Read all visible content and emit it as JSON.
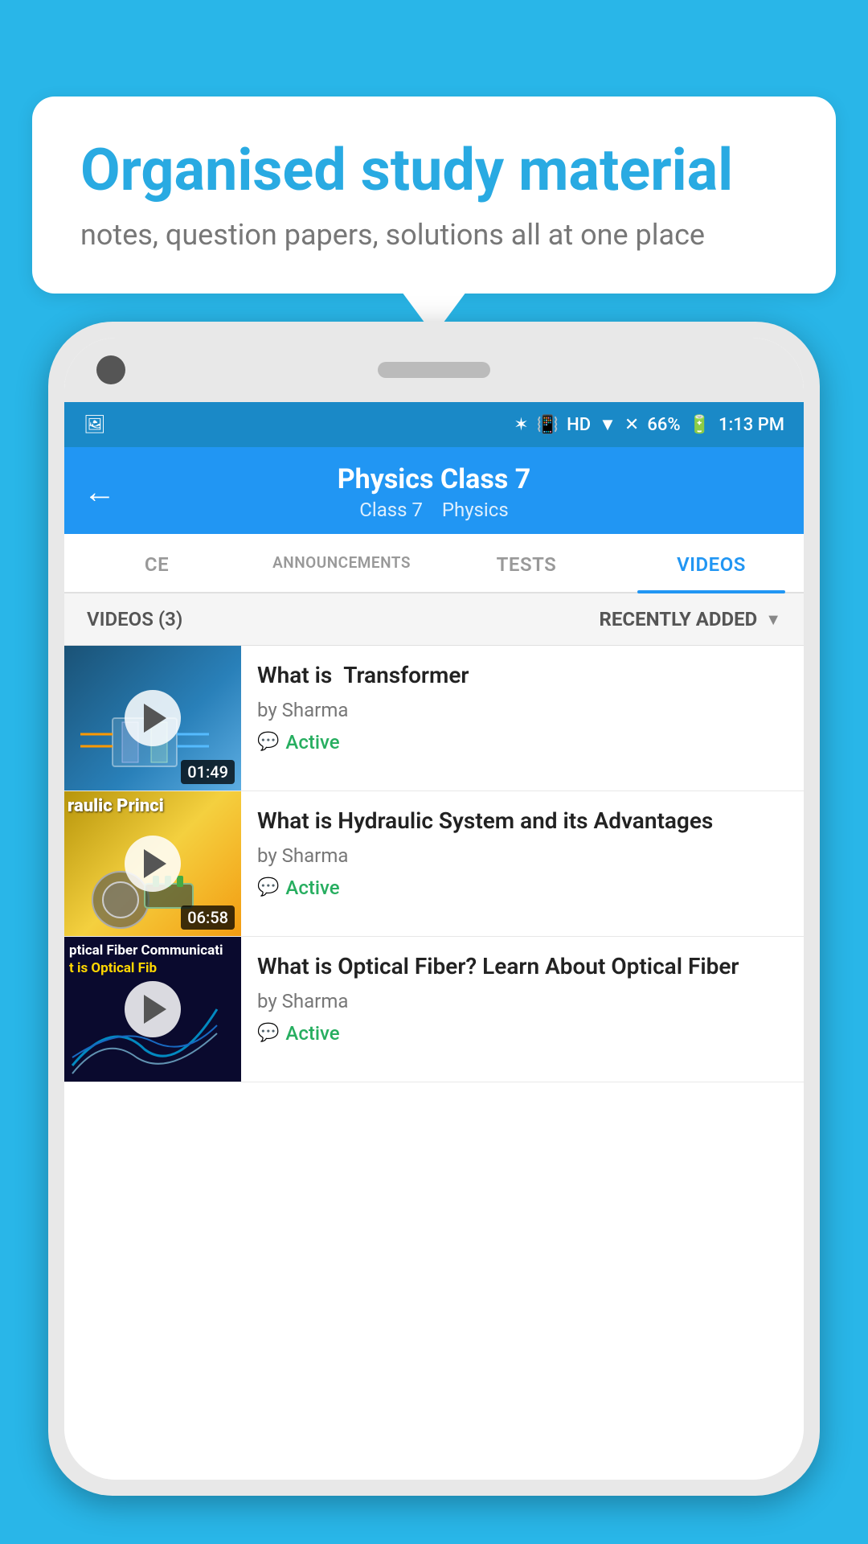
{
  "background_color": "#29b6e8",
  "speech_bubble": {
    "title": "Organised study material",
    "subtitle": "notes, question papers, solutions all at one place"
  },
  "status_bar": {
    "time": "1:13 PM",
    "battery": "66%",
    "signal_icons": "▲▲",
    "wifi_icon": "▼",
    "hd_label": "HD"
  },
  "header": {
    "title": "Physics Class 7",
    "subtitle_class": "Class 7",
    "subtitle_subject": "Physics",
    "back_label": "←"
  },
  "tabs": [
    {
      "id": "ce",
      "label": "CE",
      "active": false
    },
    {
      "id": "announcements",
      "label": "ANNOUNCEMENTS",
      "active": false
    },
    {
      "id": "tests",
      "label": "TESTS",
      "active": false
    },
    {
      "id": "videos",
      "label": "VIDEOS",
      "active": true
    }
  ],
  "filter": {
    "count_label": "VIDEOS (3)",
    "sort_label": "RECENTLY ADDED"
  },
  "videos": [
    {
      "id": 1,
      "title": "What is  Transformer",
      "author": "by Sharma",
      "duration": "01:49",
      "status": "Active",
      "thumb_type": "transformer",
      "thumb_text": ""
    },
    {
      "id": 2,
      "title": "What is Hydraulic System and its Advantages",
      "author": "by Sharma",
      "duration": "06:58",
      "status": "Active",
      "thumb_type": "hydraulic",
      "thumb_text": "raulic Princi"
    },
    {
      "id": 3,
      "title": "What is Optical Fiber? Learn About Optical Fiber",
      "author": "by Sharma",
      "duration": "",
      "status": "Active",
      "thumb_type": "optical",
      "thumb_text": "ptical Fiber Communicati"
    }
  ],
  "icons": {
    "play": "▶",
    "chat": "💬",
    "chevron_down": "▼",
    "back_arrow": "←",
    "bluetooth": "⚡",
    "vibrate": "📳"
  }
}
